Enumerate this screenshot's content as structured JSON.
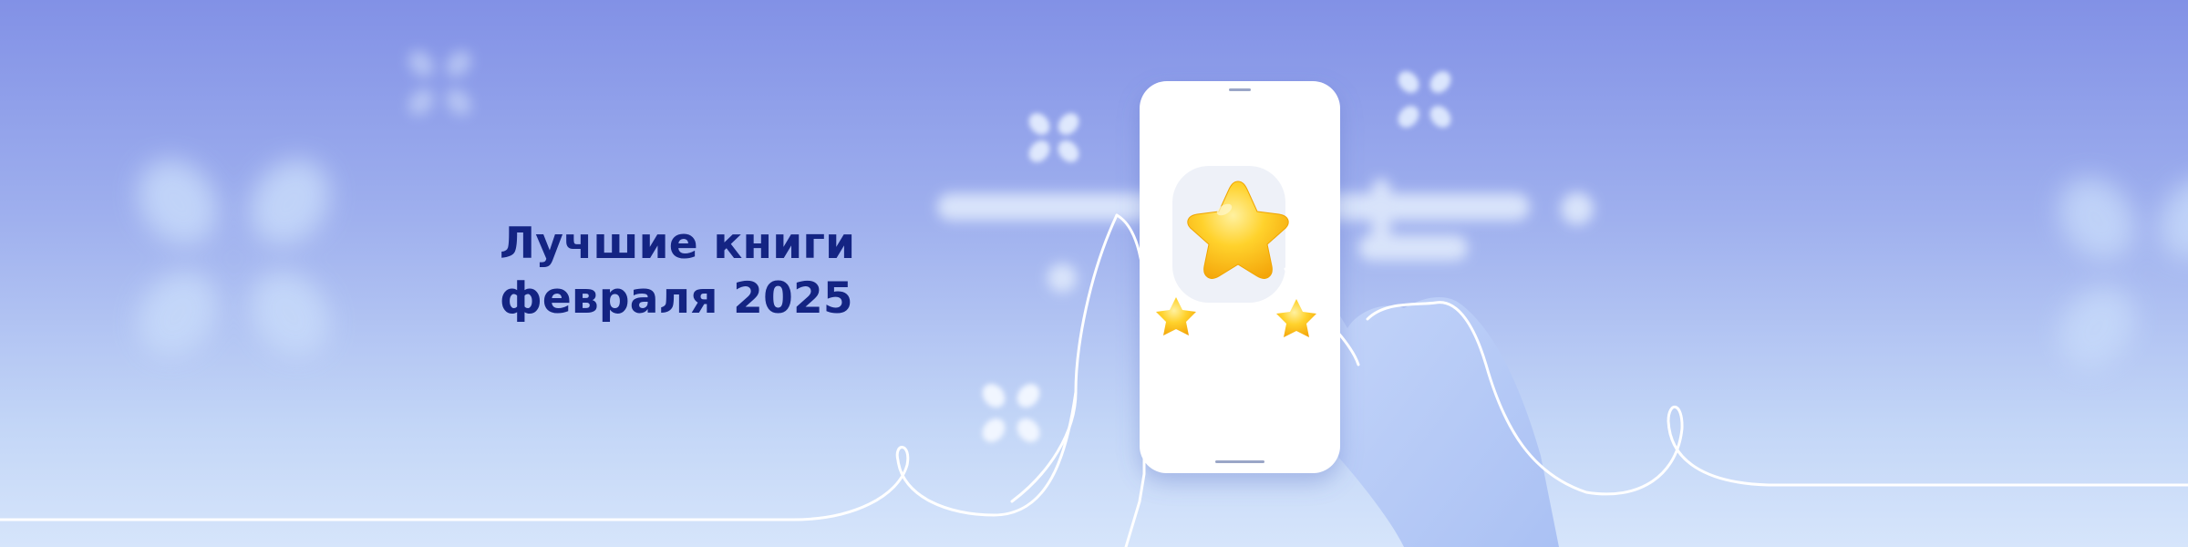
{
  "banner": {
    "title_line1": "Лучшие книги",
    "title_line2": "февраля 2025",
    "background_top_color": "#8291e6",
    "background_bottom_color": "#d6e5fb",
    "title_color": "#142483",
    "star_color": "#ffc51a",
    "phone_color": "#ffffff",
    "hand_color": "#b5cbf8"
  }
}
